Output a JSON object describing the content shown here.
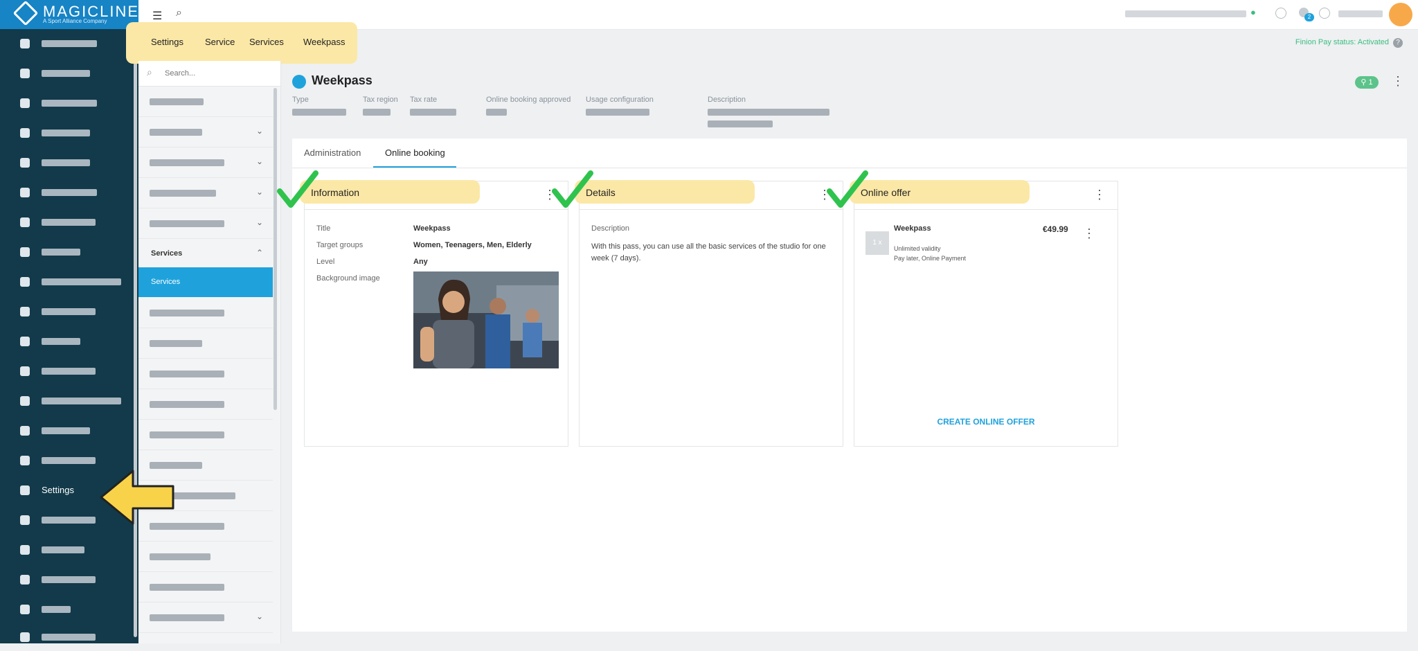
{
  "brand": {
    "name": "MAGICLINE",
    "tagline": "A Sport Alliance Company"
  },
  "leftnav": {
    "settings_label": "Settings"
  },
  "breadcrumb": [
    "Settings",
    "Service",
    "Services",
    "Weekpass"
  ],
  "finion": {
    "status": "Finion Pay status: Activated",
    "help": "?"
  },
  "notifications": {
    "count": "2"
  },
  "subnav": {
    "search_placeholder": "Search...",
    "section_title": "Services",
    "active_item": "Services"
  },
  "page": {
    "title": "Weekpass",
    "badge": "1",
    "meta_labels": [
      "Type",
      "Tax region",
      "Tax rate",
      "Online booking approved",
      "Usage configuration",
      "Description"
    ]
  },
  "tabs": {
    "administration": "Administration",
    "online_booking": "Online booking"
  },
  "info_card": {
    "title": "Information",
    "rows": [
      {
        "label": "Title",
        "value": "Weekpass"
      },
      {
        "label": "Target groups",
        "value": "Women, Teenagers, Men, Elderly"
      },
      {
        "label": "Level",
        "value": "Any"
      },
      {
        "label": "Background image",
        "value": ""
      }
    ]
  },
  "details_card": {
    "title": "Details",
    "label": "Description",
    "text": "With this pass, you can use all the basic services of the studio for one week (7 days)."
  },
  "offer_card": {
    "title": "Online offer",
    "offer_name": "Weekpass",
    "price": "€49.99",
    "thumb": "1 x",
    "validity": "Unlimited validity",
    "payment": "Pay later, Online Payment",
    "create_label": "CREATE ONLINE OFFER"
  },
  "colors": {
    "accent": "#1fa2dc",
    "nav_bg": "#123a4a",
    "highlight": "#fbe8a6",
    "success": "#3bbd7f"
  }
}
